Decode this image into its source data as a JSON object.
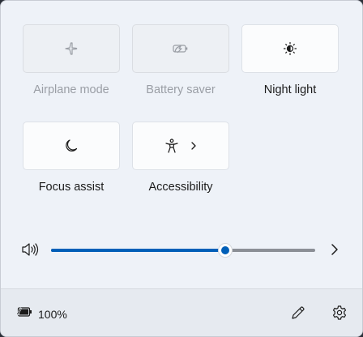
{
  "tiles": [
    {
      "label": "Airplane mode",
      "icon": "airplane-icon",
      "state": "disabled"
    },
    {
      "label": "Battery saver",
      "icon": "battery-saver-icon",
      "state": "disabled"
    },
    {
      "label": "Night light",
      "icon": "brightness-icon",
      "state": "off"
    },
    {
      "label": "Focus assist",
      "icon": "moon-icon",
      "state": "off"
    },
    {
      "label": "Accessibility",
      "icon": "accessibility-icon",
      "state": "off",
      "has_submenu": true
    }
  ],
  "volume": {
    "icon": "speaker-icon",
    "level_percent": 66
  },
  "footer": {
    "battery_text": "100%",
    "battery_icon": "battery-charging-icon",
    "edit_icon": "pencil-icon",
    "settings_icon": "gear-icon"
  },
  "colors": {
    "accent": "#005fb8",
    "panel_bg": "#eef2f8",
    "disabled_text": "#9a9ea5"
  }
}
